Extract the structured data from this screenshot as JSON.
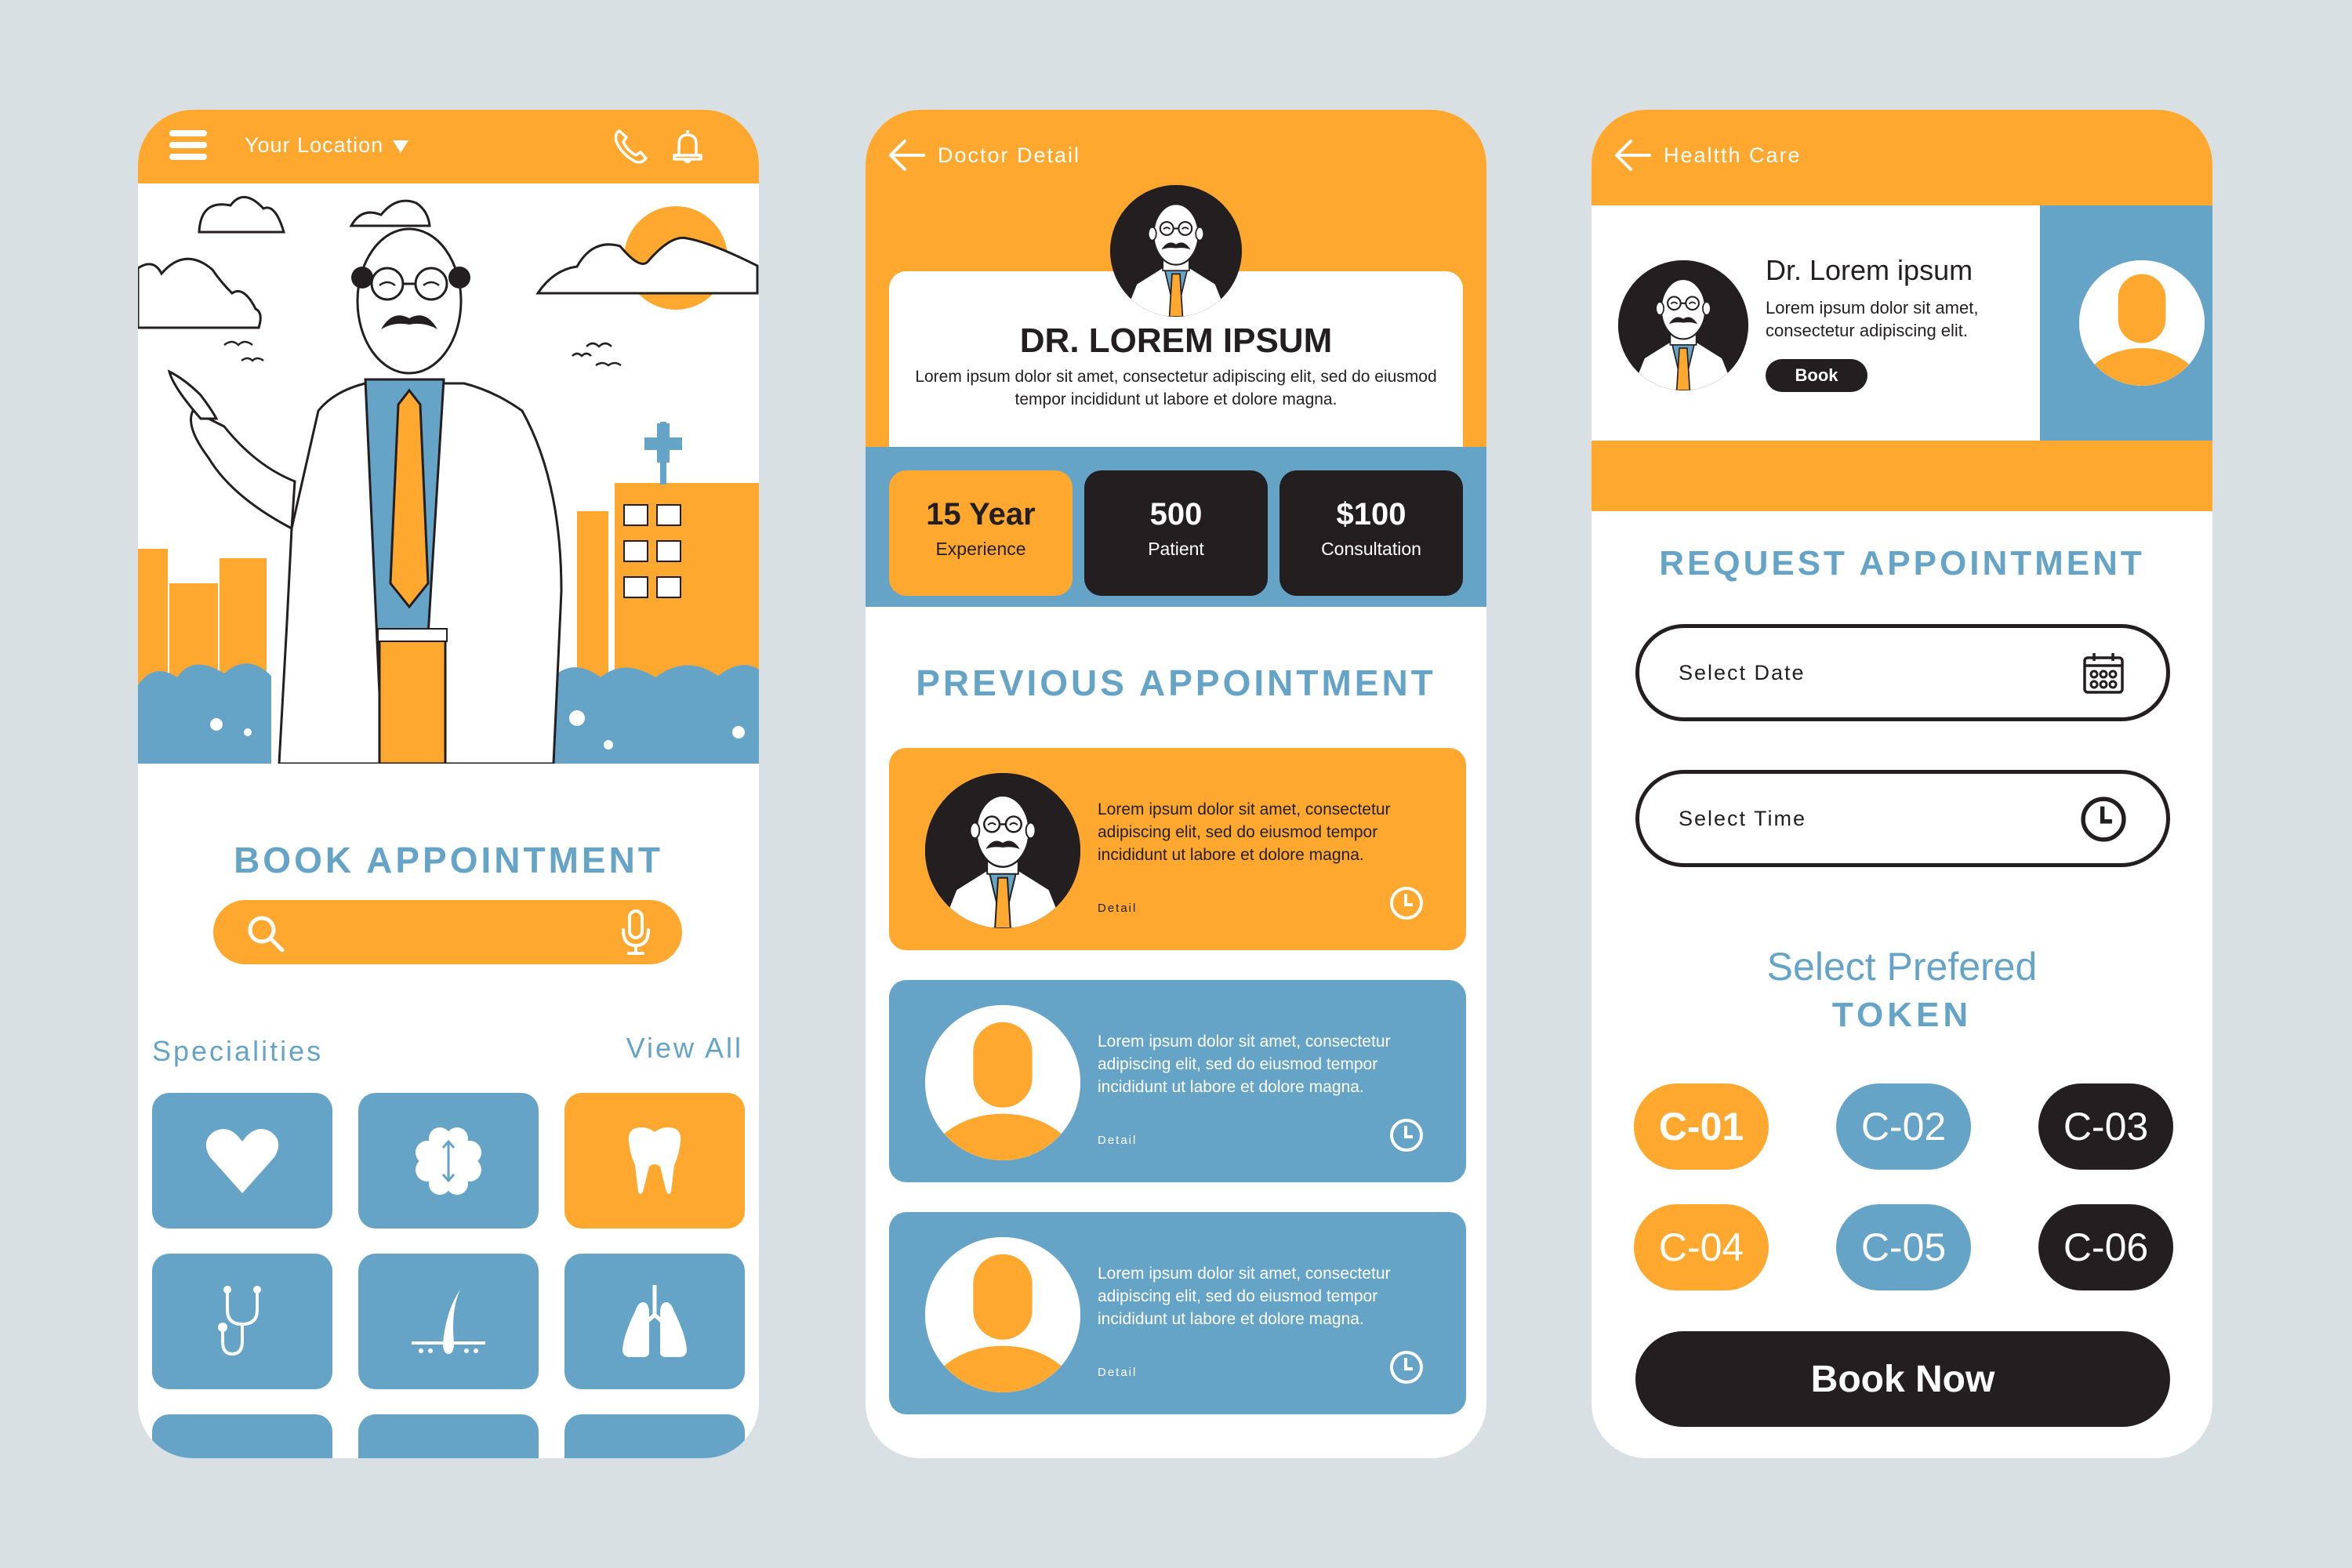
{
  "colors": {
    "orange": "#fea82f",
    "blue": "#65a4c6",
    "dark": "#231f20",
    "background": "#d8e0e3",
    "white": "#ffffff"
  },
  "home": {
    "header": {
      "menu_icon": "hamburger-menu-icon",
      "location_label": "Your Location",
      "location_icon": "caret-down-icon",
      "call_icon": "phone-icon",
      "notification_icon": "bell-icon"
    },
    "hero_illustration": "doctor-pointing-city-illustration",
    "title": "BOOK APPOINTMENT",
    "search": {
      "value": "",
      "placeholder": "",
      "search_icon": "search-icon",
      "voice_icon": "microphone-icon"
    },
    "specialities_label": "Specialities",
    "view_all_label": "View All",
    "specialities": [
      {
        "icon": "heart-icon",
        "name": "Cardiology",
        "active": false
      },
      {
        "icon": "brain-icon",
        "name": "Neurology",
        "active": false
      },
      {
        "icon": "tooth-icon",
        "name": "Dentistry",
        "active": true
      },
      {
        "icon": "stethoscope-icon",
        "name": "General",
        "active": false
      },
      {
        "icon": "hair-follicle-icon",
        "name": "Dermatology",
        "active": false
      },
      {
        "icon": "lungs-icon",
        "name": "Pulmonology",
        "active": false
      },
      {
        "icon": "blank",
        "name": "",
        "active": false
      },
      {
        "icon": "blank",
        "name": "",
        "active": false
      },
      {
        "icon": "blank",
        "name": "",
        "active": false
      }
    ]
  },
  "doctor_detail": {
    "header": {
      "back_icon": "arrow-left-icon",
      "title": "Doctor Detail"
    },
    "doctor": {
      "name": "DR. LOREM IPSUM",
      "description": "Lorem ipsum dolor sit amet, consectetur adipiscing elit, sed do eiusmod tempor incididunt ut labore et dolore magna."
    },
    "stats": [
      {
        "value": "15 Year",
        "label": "Experience",
        "highlight": true
      },
      {
        "value": "500",
        "label": "Patient",
        "highlight": false
      },
      {
        "value": "$100",
        "label": "Consultation",
        "highlight": false
      }
    ],
    "previous_title": "PREVIOUS APPOINTMENT",
    "appointments": [
      {
        "avatar": "doctor-avatar",
        "text": "Lorem ipsum dolor sit amet, consectetur adipiscing elit, sed do eiusmod tempor incididunt ut labore et dolore magna.",
        "detail_label": "Detail",
        "icon": "clock-icon",
        "color": "orange"
      },
      {
        "avatar": "user-placeholder-avatar",
        "text": "Lorem ipsum dolor sit amet, consectetur adipiscing elit, sed do eiusmod tempor incididunt ut labore et dolore magna.",
        "detail_label": "Detail",
        "icon": "clock-icon",
        "color": "blue"
      },
      {
        "avatar": "user-placeholder-avatar",
        "text": "Lorem ipsum dolor sit amet, consectetur adipiscing elit, sed do eiusmod tempor incididunt ut labore et dolore magna.",
        "detail_label": "Detail",
        "icon": "clock-icon",
        "color": "blue"
      }
    ]
  },
  "health_care": {
    "header": {
      "back_icon": "arrow-left-icon",
      "title": "Healtth Care"
    },
    "doctor_card": {
      "name": "Dr. Lorem ipsum",
      "description": "Lorem ipsum dolor sit amet, consectetur adipiscing elit.",
      "book_label": "Book"
    },
    "request_title": "REQUEST APPOINTMENT",
    "date_field": {
      "placeholder": "Select Date",
      "value": "",
      "icon": "calendar-icon"
    },
    "time_field": {
      "placeholder": "Select Time",
      "value": "",
      "icon": "clock-icon"
    },
    "token_title_line1": "Select Prefered",
    "token_title_line2": "TOKEN",
    "tokens": [
      {
        "label": "C-01",
        "color": "orange",
        "selected": true
      },
      {
        "label": "C-02",
        "color": "blue",
        "selected": false
      },
      {
        "label": "C-03",
        "color": "dark",
        "selected": false
      },
      {
        "label": "C-04",
        "color": "orange",
        "selected": false
      },
      {
        "label": "C-05",
        "color": "blue",
        "selected": false
      },
      {
        "label": "C-06",
        "color": "dark",
        "selected": false
      }
    ],
    "book_now_label": "Book Now"
  }
}
